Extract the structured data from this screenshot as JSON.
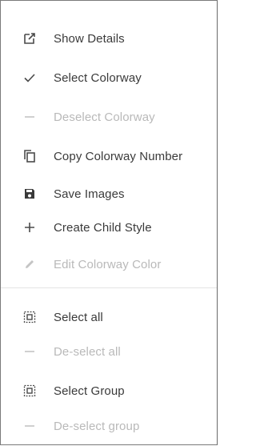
{
  "menu": {
    "items": [
      {
        "label": "Show Details",
        "icon": "open-external-icon",
        "enabled": true
      },
      {
        "label": "Select Colorway",
        "icon": "checkmark-icon",
        "enabled": true
      },
      {
        "label": "Deselect Colorway",
        "icon": "minus-icon",
        "enabled": false
      },
      {
        "label": "Copy Colorway Number",
        "icon": "copy-icon",
        "enabled": true
      },
      {
        "label": "Save Images",
        "icon": "save-icon",
        "enabled": true
      },
      {
        "label": "Create Child Style",
        "icon": "plus-icon",
        "enabled": true
      },
      {
        "label": "Edit Colorway Color",
        "icon": "pencil-icon",
        "enabled": false
      }
    ],
    "group_items": [
      {
        "label": "Select all",
        "icon": "select-all-icon",
        "enabled": true
      },
      {
        "label": "De-select all",
        "icon": "minus-icon",
        "enabled": false
      },
      {
        "label": "Select Group",
        "icon": "select-group-icon",
        "enabled": true
      },
      {
        "label": "De-select group",
        "icon": "minus-icon",
        "enabled": false
      }
    ]
  },
  "colors": {
    "text": "#3a3a3a",
    "text_disabled": "#b9b9b9",
    "icon": "#4a4a4a",
    "icon_disabled": "#c4c4c4",
    "divider": "#e4e4e4"
  }
}
